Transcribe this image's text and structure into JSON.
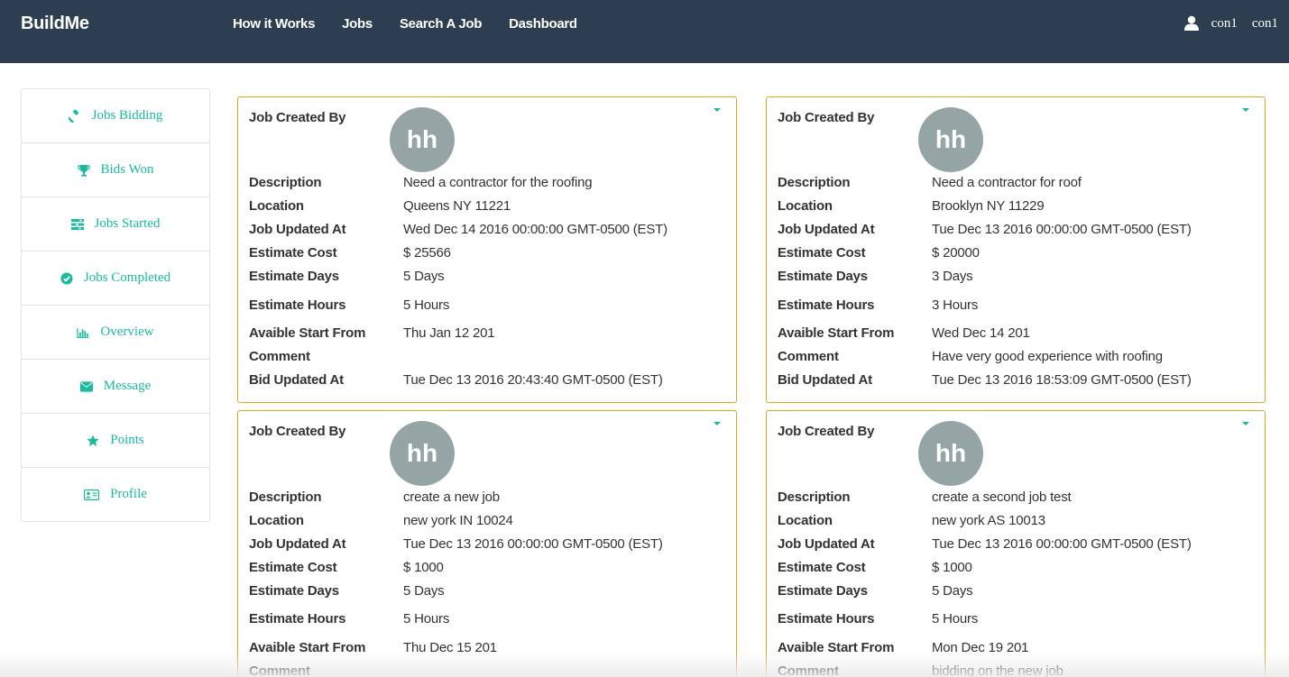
{
  "app": {
    "brand": "BuildMe",
    "nav": [
      "How it Works",
      "Jobs",
      "Search A Job",
      "Dashboard"
    ],
    "user": {
      "name1": "con1",
      "name2": "con1"
    }
  },
  "sidebar": {
    "items": [
      {
        "label": "Jobs Bidding",
        "icon": "gavel-icon"
      },
      {
        "label": "Bids Won",
        "icon": "trophy-icon"
      },
      {
        "label": "Jobs Started",
        "icon": "tasks-icon"
      },
      {
        "label": "Jobs Completed",
        "icon": "check-circle-icon"
      },
      {
        "label": "Overview",
        "icon": "bar-chart-icon"
      },
      {
        "label": "Message",
        "icon": "envelope-icon"
      },
      {
        "label": "Points",
        "icon": "star-icon"
      },
      {
        "label": "Profile",
        "icon": "id-card-icon"
      }
    ]
  },
  "labels": {
    "created_by": "Job Created By",
    "description": "Description",
    "location": "Location",
    "job_updated": "Job Updated At",
    "cost": "Estimate Cost",
    "days": "Estimate Days",
    "hours": "Estimate Hours",
    "start": "Avaible Start From",
    "comment": "Comment",
    "bid_updated": "Bid Updated At"
  },
  "cards": [
    {
      "avatar": "hh",
      "description": "Need a contractor for the roofing",
      "location": "Queens NY 11221",
      "job_updated": "Wed Dec 14 2016 00:00:00 GMT-0500 (EST)",
      "cost": "$ 25566",
      "days": "5 Days",
      "hours": "5 Hours",
      "start": "Thu Jan 12 201",
      "comment": "",
      "bid_updated": "Tue Dec 13 2016 20:43:40 GMT-0500 (EST)"
    },
    {
      "avatar": "hh",
      "description": "Need a contractor for roof",
      "location": "Brooklyn NY 11229",
      "job_updated": "Tue Dec 13 2016 00:00:00 GMT-0500 (EST)",
      "cost": "$ 20000",
      "days": "3 Days",
      "hours": "3 Hours",
      "start": "Wed Dec 14 201",
      "comment": "Have very good experience with roofing",
      "bid_updated": "Tue Dec 13 2016 18:53:09 GMT-0500 (EST)"
    },
    {
      "avatar": "hh",
      "description": "create a new job",
      "location": "new york IN 10024",
      "job_updated": "Tue Dec 13 2016 00:00:00 GMT-0500 (EST)",
      "cost": "$ 1000",
      "days": "5 Days",
      "hours": "5 Hours",
      "start": "Thu Dec 15 201",
      "comment": "",
      "bid_updated": ""
    },
    {
      "avatar": "hh",
      "description": "create a second job test",
      "location": "new york AS 10013",
      "job_updated": "Tue Dec 13 2016 00:00:00 GMT-0500 (EST)",
      "cost": "$ 1000",
      "days": "5 Days",
      "hours": "5 Hours",
      "start": "Mon Dec 19 201",
      "comment": "bidding on the new job",
      "bid_updated": ""
    }
  ]
}
